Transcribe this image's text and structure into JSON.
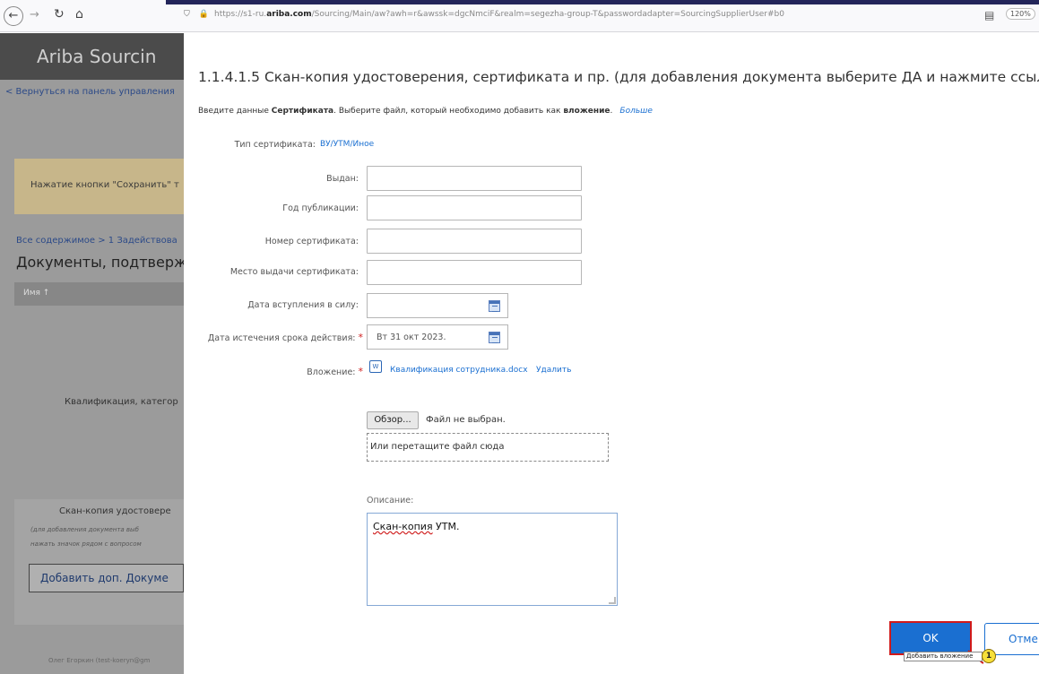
{
  "browser": {
    "url_prefix": "https://s1-ru.",
    "url_domain": "ariba.com",
    "url_rest": "/Sourcing/Main/aw?awh=r&awssk=dgcNmciF&realm=segezha-group-T&passwordadapter=SourcingSupplierUser#b0",
    "zoom": "120%"
  },
  "background": {
    "logo": "Ariba Sourcin",
    "back_link": "< Вернуться на панель управления",
    "warning": "Нажатие кнопки \"Сохранить\" т",
    "breadcrumb": "Все содержимое > 1 Задействова",
    "section_title": "Документы, подтвержда",
    "column_name": "Имя ↑",
    "row_qualification": "Квалификация, категор",
    "scan_title": "Скан-копия удостовере",
    "scan_hint_1": "(для добавления документа выб",
    "scan_hint_2": "нажать значок рядом с вопросом",
    "add_doc_button": "Добавить доп. Докуме",
    "footer_user": "Олег Егоркин (test-koeryn@gm"
  },
  "modal": {
    "title": "1.1.4.1.5 Скан-копия удостоверения, сертификата и пр. (для добавления документа выберите ДА и нажмите ссыл",
    "intro_prefix": "Введите данные ",
    "intro_bold_1": "Сертификата",
    "intro_middle": ". Выберите файл, который необходимо добавить как ",
    "intro_bold_2": "вложение",
    "intro_suffix": ".",
    "more_link": "Больше",
    "fields": {
      "cert_type_label": "Тип сертификата:",
      "cert_type_value": "ВУ/УТМ/Иное",
      "issued_by_label": "Выдан:",
      "issued_by_value": "",
      "pub_year_label": "Год публикации:",
      "pub_year_value": "",
      "cert_number_label": "Номер сертификата:",
      "cert_number_value": "",
      "issue_place_label": "Место выдачи сертификата:",
      "issue_place_value": "",
      "effective_date_label": "Дата вступления в силу:",
      "effective_date_value": "",
      "expiry_date_label": "Дата истечения срока действия:",
      "expiry_date_value": "Вт 31 окт 2023.",
      "attachment_label": "Вложение:",
      "attachment_file": "Квалификация сотрудника.docx",
      "attachment_delete": "Удалить"
    },
    "upload": {
      "browse_label": "Обзор...",
      "no_file": "Файл не выбран.",
      "drop_text": "Или перетащите файл сюда"
    },
    "description": {
      "label": "Описание:",
      "value_spell": "Скан-копия",
      "value_rest": " УТМ."
    },
    "buttons": {
      "ok": "OK",
      "cancel": "Отме"
    },
    "annotation": {
      "step_number": "1",
      "tooltip": "Добавить вложение"
    }
  }
}
